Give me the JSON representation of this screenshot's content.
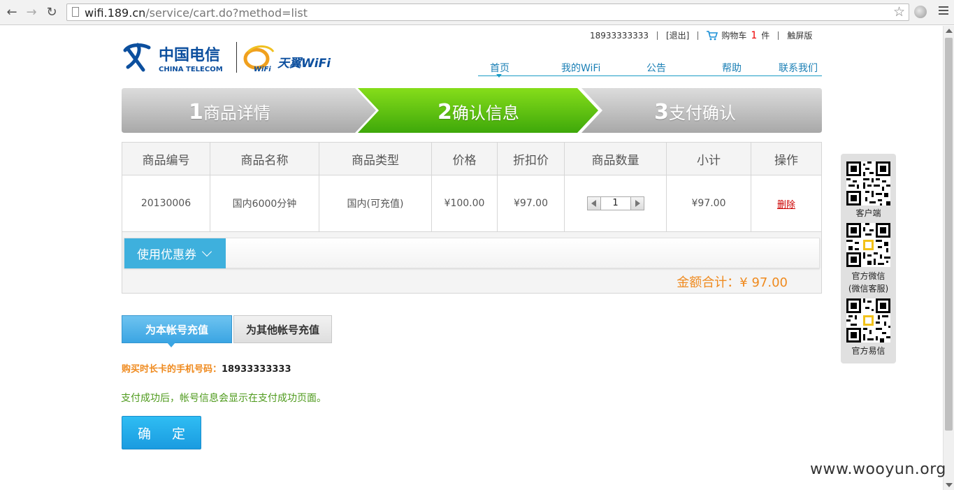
{
  "browser": {
    "url_host": "wifi.189.cn",
    "url_path": "/service/cart.do?method=list"
  },
  "topbar": {
    "phone": "18933333333",
    "logout": "[退出]",
    "cart_label": "购物车",
    "cart_count": "1",
    "cart_unit": "件",
    "touch": "触屏版"
  },
  "logos": {
    "telecom_cn": "中国电信",
    "telecom_en": "CHINA TELECOM",
    "tianyi": "天翼WiFi",
    "wifi_small": "WiFi"
  },
  "nav": {
    "items": [
      "首页",
      "我的WiFi",
      "公告",
      "帮助",
      "联系我们"
    ]
  },
  "steps": [
    {
      "num": "1",
      "label": "商品详情"
    },
    {
      "num": "2",
      "label": "确认信息"
    },
    {
      "num": "3",
      "label": "支付确认"
    }
  ],
  "table": {
    "headers": [
      "商品编号",
      "商品名称",
      "商品类型",
      "价格",
      "折扣价",
      "商品数量",
      "小计",
      "操作"
    ],
    "row": {
      "code": "20130006",
      "name": "国内6000分钟",
      "type": "国内(可充值)",
      "price": "¥100.00",
      "discount": "¥97.00",
      "qty": "1",
      "subtotal": "¥97.00",
      "action": "删除"
    }
  },
  "coupon": {
    "label": "使用优惠券"
  },
  "total": {
    "label": "金额合计：¥ 97.00"
  },
  "tabs": {
    "self": "为本帐号充值",
    "other": "为其他帐号充值"
  },
  "phone_line": {
    "label": "购买时长卡的手机号码：",
    "value": "18933333333"
  },
  "note": "支付成功后，帐号信息会显示在支付成功页面。",
  "confirm": "确 定",
  "side": {
    "client": "客户端",
    "wechat": "官方微信",
    "wechat_sub": "(微信客服)",
    "yixin": "官方易信"
  },
  "watermark": "www.wooyun.org",
  "colors": {
    "step_active": "#5cc214",
    "step_inactive": "#b9b9b9",
    "accent_blue": "#3eb0dd",
    "total_orange": "#ef8a1e",
    "note_green": "#4e9a1c"
  }
}
